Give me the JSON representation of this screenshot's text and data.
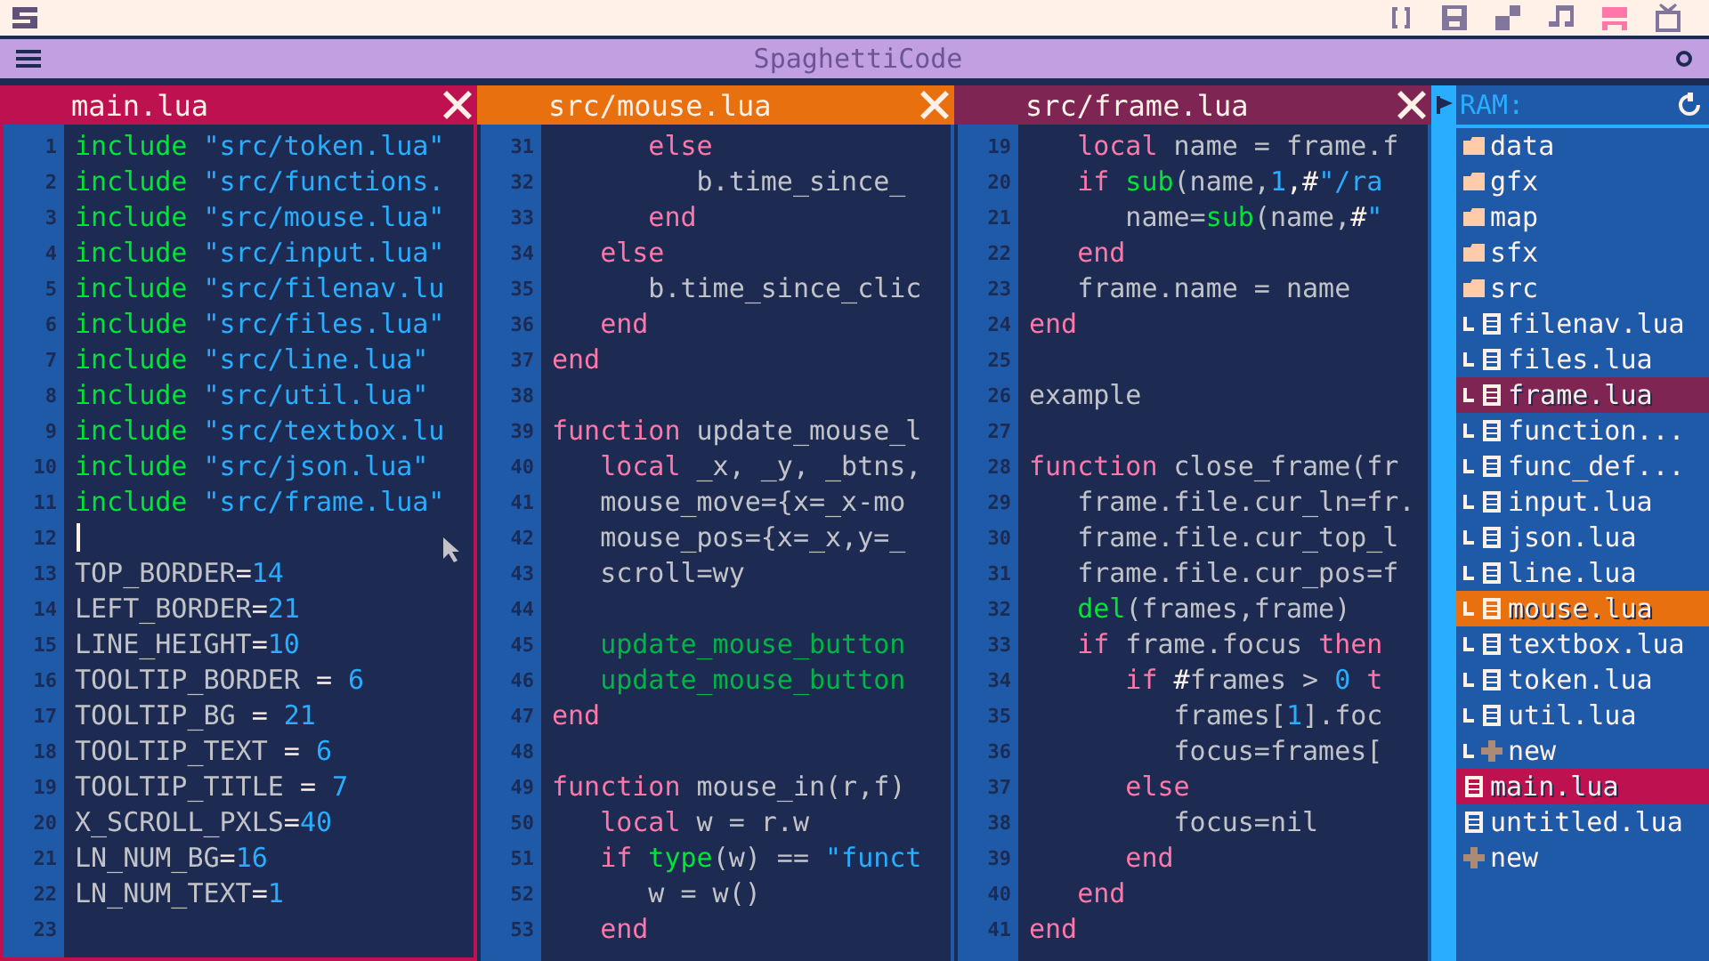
{
  "toolbar": [
    {
      "kind": "code",
      "selected": false
    },
    {
      "kind": "disk",
      "selected": false
    },
    {
      "kind": "sprite",
      "selected": false
    },
    {
      "kind": "music",
      "selected": false
    },
    {
      "kind": "map",
      "selected": true
    },
    {
      "kind": "screen",
      "selected": false
    }
  ],
  "window": {
    "title": "SpaghettiCode"
  },
  "panes": [
    {
      "tab": {
        "label": "main.lua",
        "color": "#be1250"
      },
      "focused": true,
      "lines": [
        {
          "n": "1",
          "cursor": false,
          "tokens": [
            {
              "kind": "builtin",
              "text": "include"
            },
            {
              "kind": "string",
              "text": " \"src/token.lua\""
            }
          ]
        },
        {
          "n": "2",
          "cursor": false,
          "tokens": [
            {
              "kind": "builtin",
              "text": "include"
            },
            {
              "kind": "string",
              "text": " \"src/functions."
            }
          ]
        },
        {
          "n": "3",
          "cursor": false,
          "tokens": [
            {
              "kind": "builtin",
              "text": "include"
            },
            {
              "kind": "string",
              "text": " \"src/mouse.lua\""
            }
          ]
        },
        {
          "n": "4",
          "cursor": false,
          "tokens": [
            {
              "kind": "builtin",
              "text": "include"
            },
            {
              "kind": "string",
              "text": " \"src/input.lua\""
            }
          ]
        },
        {
          "n": "5",
          "cursor": false,
          "tokens": [
            {
              "kind": "builtin",
              "text": "include"
            },
            {
              "kind": "string",
              "text": " \"src/filenav.lu"
            }
          ]
        },
        {
          "n": "6",
          "cursor": false,
          "tokens": [
            {
              "kind": "builtin",
              "text": "include"
            },
            {
              "kind": "string",
              "text": " \"src/files.lua\""
            }
          ]
        },
        {
          "n": "7",
          "cursor": false,
          "tokens": [
            {
              "kind": "builtin",
              "text": "include"
            },
            {
              "kind": "string",
              "text": " \"src/line.lua\""
            }
          ]
        },
        {
          "n": "8",
          "cursor": false,
          "tokens": [
            {
              "kind": "builtin",
              "text": "include"
            },
            {
              "kind": "string",
              "text": " \"src/util.lua\""
            }
          ]
        },
        {
          "n": "9",
          "cursor": false,
          "tokens": [
            {
              "kind": "builtin",
              "text": "include"
            },
            {
              "kind": "string",
              "text": " \"src/textbox.lu"
            }
          ]
        },
        {
          "n": "10",
          "cursor": false,
          "tokens": [
            {
              "kind": "builtin",
              "text": "include"
            },
            {
              "kind": "string",
              "text": " \"src/json.lua\""
            }
          ]
        },
        {
          "n": "11",
          "cursor": false,
          "tokens": [
            {
              "kind": "builtin",
              "text": "include"
            },
            {
              "kind": "string",
              "text": " \"src/frame.lua\""
            }
          ]
        },
        {
          "n": "12",
          "cursor": true
        },
        {
          "n": "13",
          "cursor": false,
          "tokens": [
            {
              "kind": "name",
              "text": "TOP_BORDER"
            },
            {
              "kind": "symbol",
              "text": "="
            },
            {
              "kind": "number",
              "text": "14"
            }
          ]
        },
        {
          "n": "14",
          "cursor": false,
          "tokens": [
            {
              "kind": "name",
              "text": "LEFT_BORDER"
            },
            {
              "kind": "symbol",
              "text": "="
            },
            {
              "kind": "number",
              "text": "21"
            }
          ]
        },
        {
          "n": "15",
          "cursor": false,
          "tokens": [
            {
              "kind": "name",
              "text": "LINE_HEIGHT"
            },
            {
              "kind": "symbol",
              "text": "="
            },
            {
              "kind": "number",
              "text": "10"
            }
          ]
        },
        {
          "n": "16",
          "cursor": false,
          "tokens": [
            {
              "kind": "name",
              "text": "TOOLTIP_BORDER "
            },
            {
              "kind": "symbol",
              "text": "="
            },
            {
              "kind": "number",
              "text": " 6"
            }
          ]
        },
        {
          "n": "17",
          "cursor": false,
          "tokens": [
            {
              "kind": "name",
              "text": "TOOLTIP_BG "
            },
            {
              "kind": "symbol",
              "text": "="
            },
            {
              "kind": "number",
              "text": " 21"
            }
          ]
        },
        {
          "n": "18",
          "cursor": false,
          "tokens": [
            {
              "kind": "name",
              "text": "TOOLTIP_TEXT "
            },
            {
              "kind": "symbol",
              "text": "="
            },
            {
              "kind": "number",
              "text": " 6"
            }
          ]
        },
        {
          "n": "19",
          "cursor": false,
          "tokens": [
            {
              "kind": "name",
              "text": "TOOLTIP_TITLE "
            },
            {
              "kind": "symbol",
              "text": "="
            },
            {
              "kind": "number",
              "text": " 7"
            }
          ]
        },
        {
          "n": "20",
          "cursor": false,
          "tokens": [
            {
              "kind": "name",
              "text": "X_SCROLL_PXLS"
            },
            {
              "kind": "symbol",
              "text": "="
            },
            {
              "kind": "number",
              "text": "40"
            }
          ]
        },
        {
          "n": "21",
          "cursor": false,
          "tokens": [
            {
              "kind": "name",
              "text": "LN_NUM_BG"
            },
            {
              "kind": "symbol",
              "text": "="
            },
            {
              "kind": "number",
              "text": "16"
            }
          ]
        },
        {
          "n": "22",
          "cursor": false,
          "tokens": [
            {
              "kind": "name",
              "text": "LN_NUM_TEXT"
            },
            {
              "kind": "symbol",
              "text": "="
            },
            {
              "kind": "number",
              "text": "1"
            }
          ]
        },
        {
          "n": "23",
          "cursor": false
        }
      ]
    },
    {
      "tab": {
        "label": "src/mouse.lua",
        "color": "#e8700e"
      },
      "focused": false,
      "lines": [
        {
          "n": "31",
          "tokens": [
            {
              "kind": "keyword",
              "text": "      else"
            }
          ]
        },
        {
          "n": "32",
          "tokens": [
            {
              "kind": "name",
              "text": "         b.time_since_"
            }
          ]
        },
        {
          "n": "33",
          "tokens": [
            {
              "kind": "keyword",
              "text": "      end"
            }
          ]
        },
        {
          "n": "34",
          "tokens": [
            {
              "kind": "keyword",
              "text": "   else"
            }
          ]
        },
        {
          "n": "35",
          "tokens": [
            {
              "kind": "name",
              "text": "      b.time_since_clic"
            }
          ]
        },
        {
          "n": "36",
          "tokens": [
            {
              "kind": "keyword",
              "text": "   end"
            }
          ]
        },
        {
          "n": "37",
          "tokens": [
            {
              "kind": "keyword",
              "text": "end"
            }
          ]
        },
        {
          "n": "38"
        },
        {
          "n": "39",
          "tokens": [
            {
              "kind": "keyword",
              "text": "function"
            },
            {
              "kind": "name",
              "text": " update_mouse_l"
            }
          ]
        },
        {
          "n": "40",
          "tokens": [
            {
              "kind": "keyword",
              "text": "   local"
            },
            {
              "kind": "name",
              "text": " _x, _y, _btns,"
            }
          ]
        },
        {
          "n": "41",
          "tokens": [
            {
              "kind": "name",
              "text": "   mouse_move={x=_x-mo"
            }
          ]
        },
        {
          "n": "42",
          "tokens": [
            {
              "kind": "name",
              "text": "   mouse_pos={x=_x,y=_"
            }
          ]
        },
        {
          "n": "43",
          "tokens": [
            {
              "kind": "name",
              "text": "   scroll=wy"
            }
          ]
        },
        {
          "n": "44"
        },
        {
          "n": "45",
          "tokens": [
            {
              "kind": "call",
              "text": "   update_mouse_button"
            }
          ]
        },
        {
          "n": "46",
          "tokens": [
            {
              "kind": "call",
              "text": "   update_mouse_button"
            }
          ]
        },
        {
          "n": "47",
          "tokens": [
            {
              "kind": "keyword",
              "text": "end"
            }
          ]
        },
        {
          "n": "48"
        },
        {
          "n": "49",
          "tokens": [
            {
              "kind": "keyword",
              "text": "function"
            },
            {
              "kind": "name",
              "text": " mouse_in(r,f)"
            }
          ]
        },
        {
          "n": "50",
          "tokens": [
            {
              "kind": "keyword",
              "text": "   local"
            },
            {
              "kind": "name",
              "text": " w = r.w"
            }
          ]
        },
        {
          "n": "51",
          "tokens": [
            {
              "kind": "keyword",
              "text": "   if"
            },
            {
              "kind": "builtin",
              "text": " type"
            },
            {
              "kind": "name",
              "text": "(w) == "
            },
            {
              "kind": "string",
              "text": "\"funct"
            }
          ]
        },
        {
          "n": "52",
          "tokens": [
            {
              "kind": "name",
              "text": "      w = w()"
            }
          ]
        },
        {
          "n": "53",
          "tokens": [
            {
              "kind": "keyword",
              "text": "   end"
            }
          ]
        }
      ]
    },
    {
      "tab": {
        "label": "src/frame.lua",
        "color": "#7e2553"
      },
      "focused": false,
      "lines": [
        {
          "n": "19",
          "tokens": [
            {
              "kind": "keyword",
              "text": "   local"
            },
            {
              "kind": "name",
              "text": " name = frame.f"
            }
          ]
        },
        {
          "n": "20",
          "tokens": [
            {
              "kind": "keyword",
              "text": "   if"
            },
            {
              "kind": "builtin",
              "text": " sub"
            },
            {
              "kind": "name",
              "text": "(name,"
            },
            {
              "kind": "number",
              "text": "1"
            },
            {
              "kind": "symbol",
              "text": ",#"
            },
            {
              "kind": "string",
              "text": "\"/ra"
            }
          ]
        },
        {
          "n": "21",
          "tokens": [
            {
              "kind": "name",
              "text": "      name="
            },
            {
              "kind": "builtin",
              "text": "sub"
            },
            {
              "kind": "name",
              "text": "(name,"
            },
            {
              "kind": "symbol",
              "text": "#"
            },
            {
              "kind": "string",
              "text": "\""
            }
          ]
        },
        {
          "n": "22",
          "tokens": [
            {
              "kind": "keyword",
              "text": "   end"
            }
          ]
        },
        {
          "n": "23",
          "tokens": [
            {
              "kind": "name",
              "text": "   frame.name = name"
            }
          ]
        },
        {
          "n": "24",
          "tokens": [
            {
              "kind": "keyword",
              "text": "end"
            }
          ]
        },
        {
          "n": "25"
        },
        {
          "n": "26",
          "tokens": [
            {
              "kind": "name",
              "text": "example"
            }
          ]
        },
        {
          "n": "27"
        },
        {
          "n": "28",
          "tokens": [
            {
              "kind": "keyword",
              "text": "function"
            },
            {
              "kind": "name",
              "text": " close_frame(fr"
            }
          ]
        },
        {
          "n": "29",
          "tokens": [
            {
              "kind": "name",
              "text": "   frame.file.cur_ln=fr."
            }
          ]
        },
        {
          "n": "30",
          "tokens": [
            {
              "kind": "name",
              "text": "   frame.file.cur_top_l"
            }
          ]
        },
        {
          "n": "31",
          "tokens": [
            {
              "kind": "name",
              "text": "   frame.file.cur_pos=f"
            }
          ]
        },
        {
          "n": "32",
          "tokens": [
            {
              "kind": "builtin",
              "text": "   del"
            },
            {
              "kind": "name",
              "text": "(frames,frame)"
            }
          ]
        },
        {
          "n": "33",
          "tokens": [
            {
              "kind": "keyword",
              "text": "   if"
            },
            {
              "kind": "name",
              "text": " frame.focus "
            },
            {
              "kind": "keyword",
              "text": "then"
            }
          ]
        },
        {
          "n": "34",
          "tokens": [
            {
              "kind": "keyword",
              "text": "      if"
            },
            {
              "kind": "symbol",
              "text": " #"
            },
            {
              "kind": "name",
              "text": "frames > "
            },
            {
              "kind": "number",
              "text": "0"
            },
            {
              "kind": "keyword",
              "text": " t"
            }
          ]
        },
        {
          "n": "35",
          "tokens": [
            {
              "kind": "name",
              "text": "         frames["
            },
            {
              "kind": "number",
              "text": "1"
            },
            {
              "kind": "name",
              "text": "].foc"
            }
          ]
        },
        {
          "n": "36",
          "tokens": [
            {
              "kind": "name",
              "text": "         focus=frames["
            }
          ]
        },
        {
          "n": "37",
          "tokens": [
            {
              "kind": "keyword",
              "text": "      else"
            }
          ]
        },
        {
          "n": "38",
          "tokens": [
            {
              "kind": "name",
              "text": "         focus=nil"
            }
          ]
        },
        {
          "n": "39",
          "tokens": [
            {
              "kind": "keyword",
              "text": "      end"
            }
          ]
        },
        {
          "n": "40",
          "tokens": [
            {
              "kind": "keyword",
              "text": "   end"
            }
          ]
        },
        {
          "n": "41",
          "tokens": [
            {
              "kind": "keyword",
              "text": "end"
            }
          ]
        }
      ]
    }
  ],
  "sidebar": {
    "title": "RAM:",
    "items": [
      {
        "kind": "folder",
        "label": "data"
      },
      {
        "kind": "folder",
        "label": "gfx"
      },
      {
        "kind": "folder",
        "label": "map"
      },
      {
        "kind": "folder",
        "label": "sfx"
      },
      {
        "kind": "folder",
        "label": "src",
        "children": [
          {
            "kind": "file",
            "label": "filenav.lua"
          },
          {
            "kind": "file",
            "label": "files.lua"
          },
          {
            "kind": "file",
            "label": "frame.lua",
            "color": "#7e2553"
          },
          {
            "kind": "file",
            "label": "function..."
          },
          {
            "kind": "file",
            "label": "func_def..."
          },
          {
            "kind": "file",
            "label": "input.lua"
          },
          {
            "kind": "file",
            "label": "json.lua"
          },
          {
            "kind": "file",
            "label": "line.lua"
          },
          {
            "kind": "file",
            "label": "mouse.lua",
            "color": "#e8700e"
          },
          {
            "kind": "file",
            "label": "textbox.lua"
          },
          {
            "kind": "file",
            "label": "token.lua"
          },
          {
            "kind": "file",
            "label": "util.lua"
          },
          {
            "kind": "new",
            "label": "new"
          }
        ]
      },
      {
        "kind": "file",
        "label": "main.lua",
        "color": "#be1250"
      },
      {
        "kind": "file",
        "label": "untitled.lua"
      },
      {
        "kind": "new",
        "label": "new"
      }
    ]
  }
}
